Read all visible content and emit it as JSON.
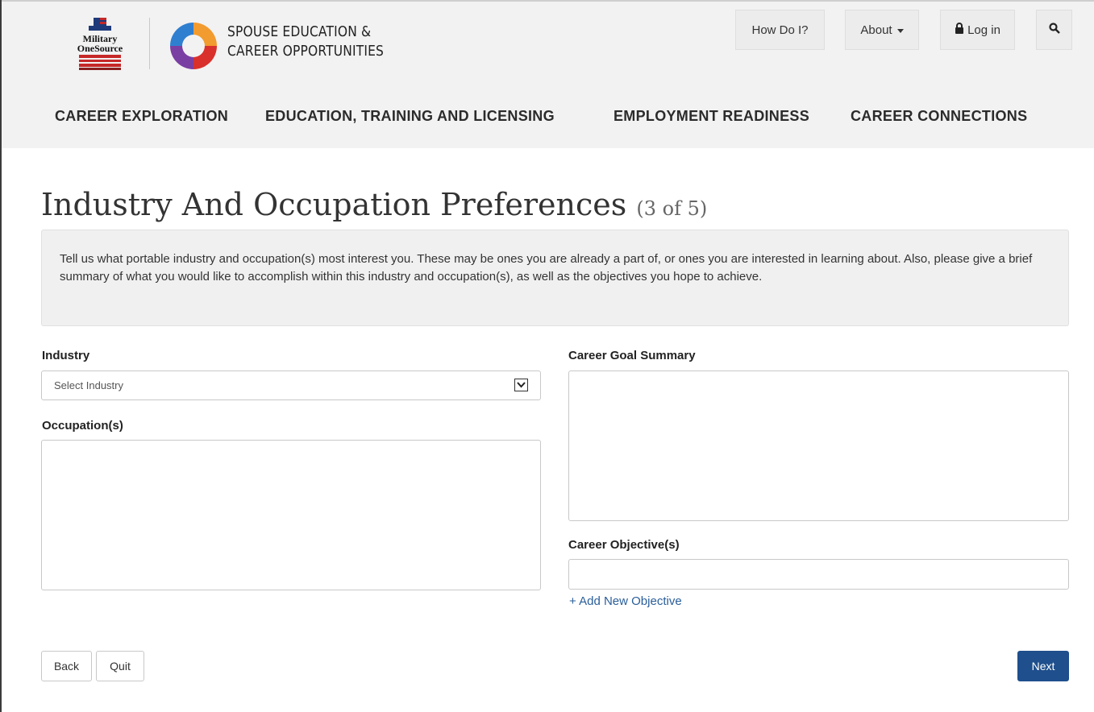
{
  "header": {
    "logo_military_line1": "Military",
    "logo_military_line2": "OneSource",
    "seco_line1": "SPOUSE EDUCATION &",
    "seco_line2": "CAREER OPPORTUNITIES",
    "how_do_i": "How Do I?",
    "about": "About",
    "login": "Log in"
  },
  "nav": {
    "items": [
      {
        "label": "CAREER EXPLORATION"
      },
      {
        "label": "EDUCATION, TRAINING AND LICENSING"
      },
      {
        "label": "EMPLOYMENT READINESS"
      },
      {
        "label": "CAREER CONNECTIONS"
      }
    ]
  },
  "page": {
    "title": "Industry And Occupation Preferences",
    "step": "(3 of 5)",
    "intro": "Tell us what portable industry and occupation(s) most interest you. These may be ones you are already a part of, or ones you are interested in learning about. Also, please give a brief summary of what you would like to accomplish within this industry and occupation(s), as well as the objectives you hope to achieve."
  },
  "form": {
    "industry_label": "Industry",
    "industry_placeholder": "Select Industry",
    "occupation_label": "Occupation(s)",
    "goal_label": "Career Goal Summary",
    "objective_label": "Career Objective(s)",
    "add_objective": "+ Add New Objective"
  },
  "footer": {
    "back": "Back",
    "quit": "Quit",
    "next": "Next"
  },
  "colors": {
    "accent": "#1f4f8c",
    "link": "#2a5e9a",
    "header_bg": "#f2f2f2"
  }
}
